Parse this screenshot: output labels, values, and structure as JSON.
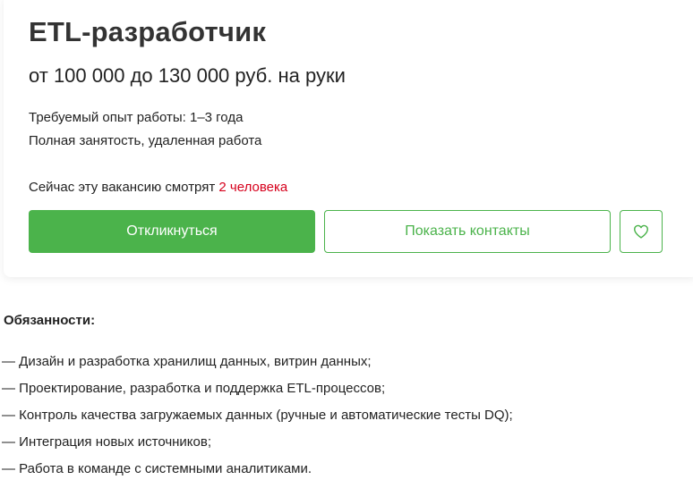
{
  "vacancy": {
    "title": "ETL-разработчик",
    "salary": "от 100 000 до 130 000 руб. на руки",
    "experience": "Требуемый опыт работы: 1–3 года",
    "employment": "Полная занятость, удаленная работа",
    "viewers_prefix": "Сейчас эту вакансию смотрят",
    "viewers_count": "2 человека"
  },
  "actions": {
    "respond_label": "Откликнуться",
    "contacts_label": "Показать контакты",
    "favorite_icon": "heart-icon"
  },
  "colors": {
    "accent_green": "#4bb34b",
    "viewers_red": "#d6001c"
  },
  "duties": {
    "title": "Обязанности:",
    "items": [
      "— Дизайн и разработка хранилищ данных, витрин данных;",
      "— Проектирование, разработка и поддержка ETL-процессов;",
      "— Контроль качества загружаемых данных (ручные и автоматические тесты DQ);",
      "— Интеграция новых источников;",
      "— Работа в команде с системными аналитиками."
    ]
  }
}
